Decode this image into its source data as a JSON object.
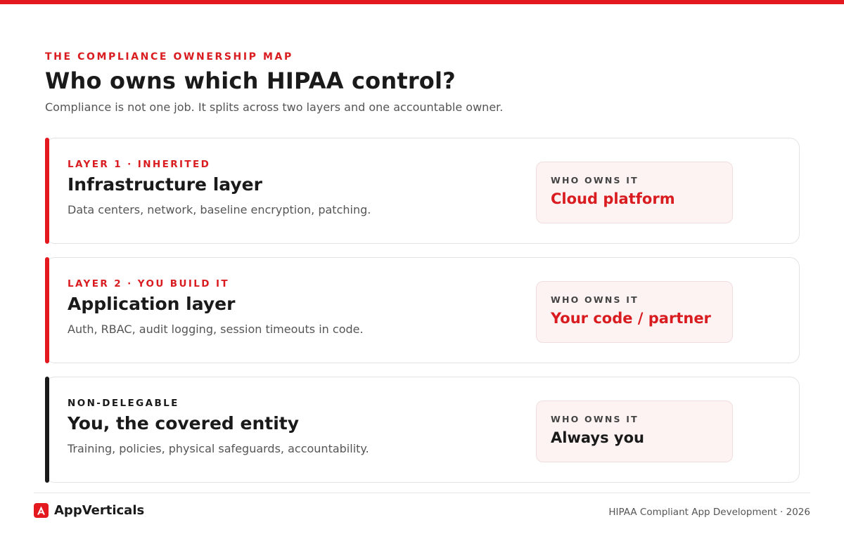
{
  "header": {
    "eyebrow": "THE COMPLIANCE OWNERSHIP MAP",
    "title": "Who owns which HIPAA control?",
    "subtitle": "Compliance is not one job. It splits across two layers and one accountable owner."
  },
  "layers": [
    {
      "tag": "LAYER 1 · INHERITED",
      "name": "Infrastructure layer",
      "description": "Data centers, network, baseline encryption, patching.",
      "owner_label": "WHO OWNS IT",
      "owner": "Cloud platform",
      "accent_color": "#e3191f",
      "tag_color": "#d91c20",
      "owner_color": "#d91c20"
    },
    {
      "tag": "LAYER 2 · YOU BUILD IT",
      "name": "Application layer",
      "description": "Auth, RBAC, audit logging, session timeouts in code.",
      "owner_label": "WHO OWNS IT",
      "owner": "Your code / partner",
      "accent_color": "#e3191f",
      "tag_color": "#d91c20",
      "owner_color": "#d91c20"
    },
    {
      "tag": "NON-DELEGABLE",
      "name": "You, the covered entity",
      "description": "Training, policies, physical safeguards, accountability.",
      "owner_label": "WHO OWNS IT",
      "owner": "Always you",
      "accent_color": "#1a1a1a",
      "tag_color": "#1a1a1a",
      "owner_color": "#1a1a1a"
    }
  ],
  "footer": {
    "brand": "AppVerticals",
    "brand_icon": "appverticals-logo-icon",
    "tagline": "HIPAA Compliant App Development · 2026"
  },
  "colors": {
    "accent": "#e3191f",
    "text": "#1a1a1a",
    "muted": "#555555",
    "owner_box_bg": "#fdf3f3"
  }
}
